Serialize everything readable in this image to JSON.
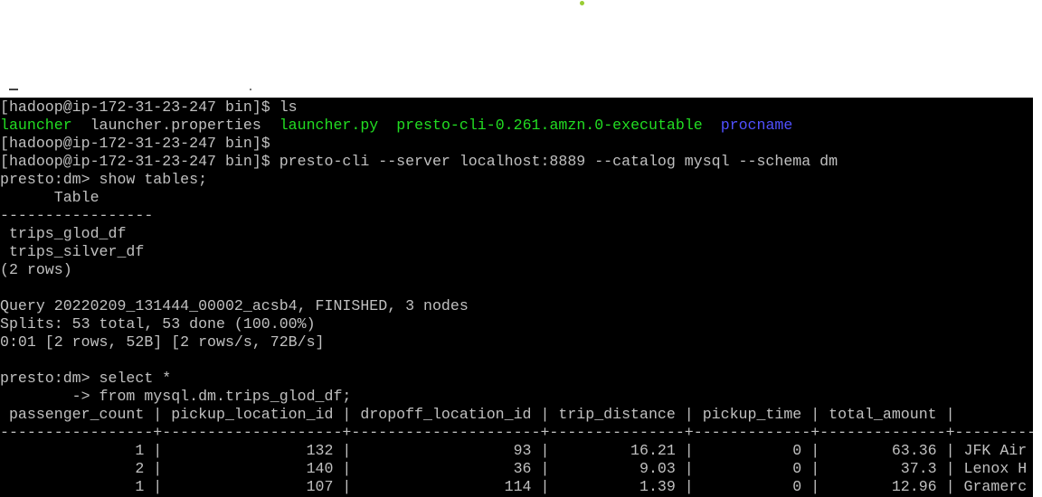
{
  "colors": {
    "terminal_bg": "#000000",
    "text": "#c0c0c0",
    "executable": "#22dd22",
    "file": "#22dd22",
    "directory": "#5050ff",
    "dot": "#99cc33"
  },
  "terminal": {
    "cmd_ls": "[hadoop@ip-172-31-23-247 bin]$ ls",
    "ls_output": [
      {
        "text": "launcher",
        "kind": "executable"
      },
      {
        "text": "  ",
        "kind": "plain"
      },
      {
        "text": "launcher.properties",
        "kind": "plain"
      },
      {
        "text": "  ",
        "kind": "plain"
      },
      {
        "text": "launcher.py",
        "kind": "executable"
      },
      {
        "text": "  ",
        "kind": "plain"
      },
      {
        "text": "presto-cli-0.261.amzn.0-executable",
        "kind": "executable"
      },
      {
        "text": "  ",
        "kind": "plain"
      },
      {
        "text": "procname",
        "kind": "directory"
      }
    ],
    "prompt_empty": "[hadoop@ip-172-31-23-247 bin]$",
    "cmd_presto": "[hadoop@ip-172-31-23-247 bin]$ presto-cli --server localhost:8889 --catalog mysql --schema dm",
    "show_tables": "presto:dm> show tables;",
    "tables_header": "      Table",
    "tables_rule": "-----------------",
    "tables": [
      " trips_glod_df",
      " trips_silver_df"
    ],
    "rows_count": "(2 rows)",
    "query_status": "Query 20220209_131444_00002_acsb4, FINISHED, 3 nodes",
    "splits": "Splits: 53 total, 53 done (100.00%)",
    "timing": "0:01 [2 rows, 52B] [2 rows/s, 72B/s]",
    "select_line1": "presto:dm> select *",
    "select_line2": "        -> from mysql.dm.trips_glod_df;",
    "result_header": " passenger_count | pickup_location_id | dropoff_location_id | trip_distance | pickup_time | total_amount |",
    "result_rule": "-----------------+--------------------+---------------------+---------------+-------------+--------------+---------",
    "result_rows": [
      "               1 |                132 |                  93 |         16.21 |           0 |        63.36 | JFK Air",
      "               2 |                140 |                  36 |          9.03 |           0 |         37.3 | Lenox H",
      "               1 |                107 |                 114 |          1.39 |           0 |        12.96 | Gramerc"
    ]
  }
}
